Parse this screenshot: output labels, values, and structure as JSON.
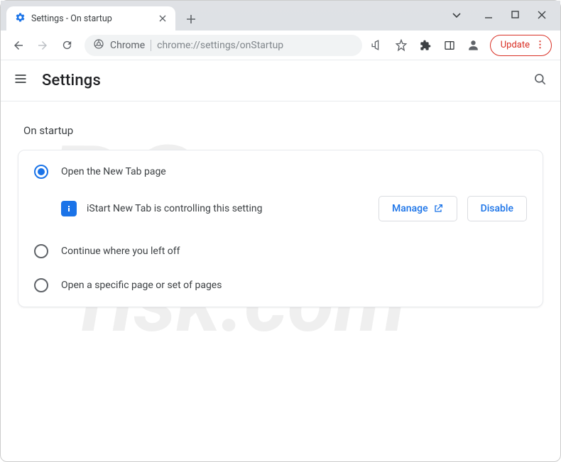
{
  "tab": {
    "title": "Settings - On startup"
  },
  "omnibox": {
    "prefix": "Chrome",
    "path": "chrome://settings/onStartup"
  },
  "update": {
    "label": "Update"
  },
  "header": {
    "title": "Settings"
  },
  "section": {
    "label": "On startup"
  },
  "options": {
    "newTab": "Open the New Tab page",
    "continue": "Continue where you left off",
    "specific": "Open a specific page or set of pages"
  },
  "extension": {
    "notice": "iStart New Tab is controlling this setting",
    "manage": "Manage",
    "disable": "Disable"
  }
}
